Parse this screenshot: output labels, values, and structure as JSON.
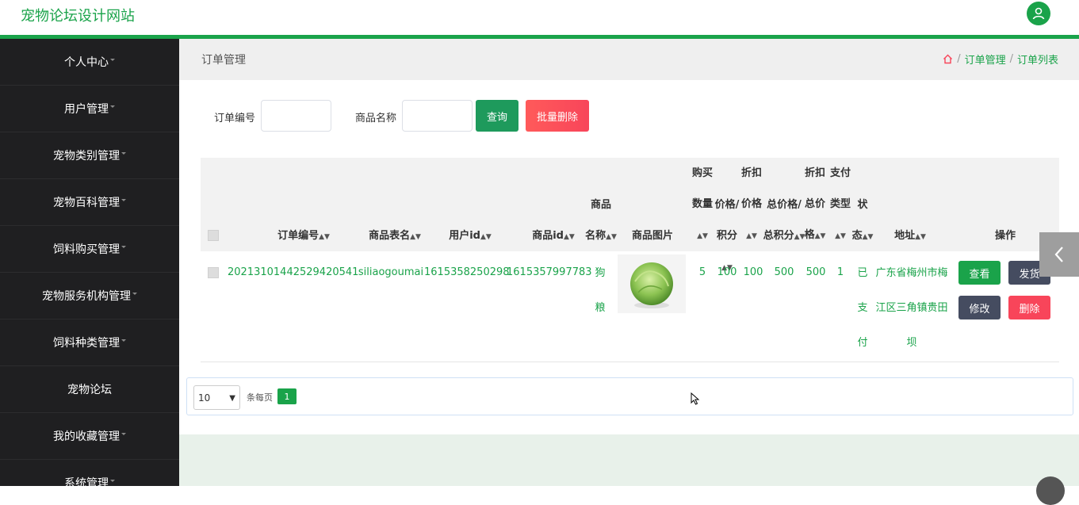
{
  "header": {
    "brand": "宠物论坛设计网站"
  },
  "sidebar": {
    "items": [
      {
        "label": "个人中心"
      },
      {
        "label": "用户管理"
      },
      {
        "label": "宠物类别管理"
      },
      {
        "label": "宠物百科管理"
      },
      {
        "label": "饲料购买管理"
      },
      {
        "label": "宠物服务机构管理"
      },
      {
        "label": "饲料种类管理"
      },
      {
        "label": "宠物论坛"
      },
      {
        "label": "我的收藏管理"
      },
      {
        "label": "系统管理"
      }
    ]
  },
  "page": {
    "title": "订单管理",
    "breadcrumb": [
      "订单管理",
      "订单列表"
    ]
  },
  "search": {
    "order_no_label": "订单编号",
    "order_no_value": "",
    "product_label": "商品名称",
    "product_value": "",
    "query_button": "查询",
    "batch_delete_button": "批量删除"
  },
  "table": {
    "headers": {
      "order_no": "订单编号",
      "table_name": "商品表名",
      "user_id": "用户id",
      "product_id": "商品id",
      "name_l1": "商品",
      "name_l2": "名称",
      "image": "商品图片",
      "qty_l1": "购买",
      "qty_l2": "数量",
      "price_l1": "价格/",
      "price_l2": "积分",
      "disc_l1": "折扣",
      "disc_l2": "价格",
      "total_l1": "总价格/",
      "total_l2": "总积分",
      "dtotal_l1": "折扣",
      "dtotal_l2": "总价",
      "dtotal_l3": "格",
      "pay_l1": "支付",
      "pay_l2": "类型",
      "status_l1": "状",
      "status_l2": "态",
      "address": "地址",
      "actions": "操作"
    },
    "rows": [
      {
        "order_no": "20213101442529420541",
        "table_name": "siliaogoumai",
        "user_id": "1615358250298",
        "product_id": "1615357997783",
        "name_l1": "狗",
        "name_l2": "粮",
        "qty": "5",
        "price": "100",
        "disc_price": "100",
        "total": "500",
        "disc_total": "500",
        "pay_type": "1",
        "status_l1": "已",
        "status_l2": "支",
        "status_l3": "付",
        "address_l1": "广东省梅州市梅",
        "address_l2": "江区三角镇贵田",
        "address_l3": "坝",
        "actions": {
          "view": "查看",
          "ship": "发货",
          "edit": "修改",
          "delete": "删除"
        }
      }
    ]
  },
  "pagination": {
    "page_size": "10",
    "per_page_label": "条每页",
    "current_page": "1"
  },
  "colors": {
    "brand": "#1aa34a",
    "sidebar_bg": "#1f1f21",
    "danger": "#f8455a",
    "dark_button": "#454c60"
  }
}
